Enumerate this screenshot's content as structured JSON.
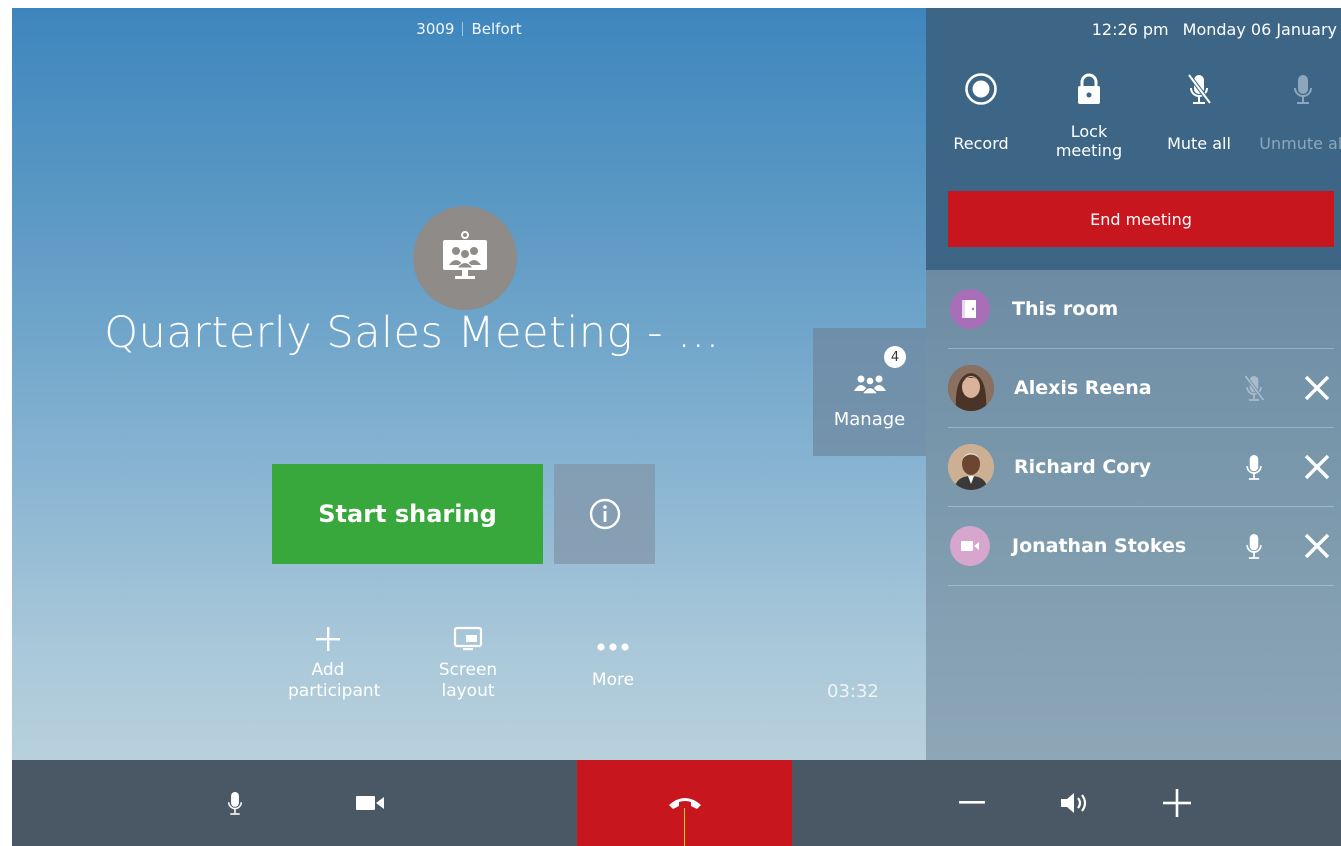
{
  "status": {
    "room_number": "3009",
    "room_name": "Belfort",
    "time": "12:26 pm",
    "date": "Monday 06 January"
  },
  "meeting": {
    "title": "Quarterly Sales Meeting - ...",
    "timer": "03:32",
    "icon": "video-conference-icon"
  },
  "main_actions": {
    "start_sharing": "Start sharing",
    "info_icon": "info-icon",
    "add_participant": "Add participant",
    "screen_layout": "Screen layout",
    "more": "More"
  },
  "manage": {
    "label": "Manage",
    "count": "4",
    "icon": "people-icon"
  },
  "panel": {
    "controls": {
      "record": "Record",
      "lock": "Lock meeting",
      "mute_all": "Mute all",
      "unmute_all": "Unmute all"
    },
    "end_meeting": "End meeting",
    "participants": [
      {
        "name": "This room",
        "avatar": "door-icon",
        "avatar_color": "#a86fb8"
      },
      {
        "name": "Alexis Reena",
        "avatar": "photo",
        "mic": "muted"
      },
      {
        "name": "Richard Cory",
        "avatar": "photo",
        "mic": "on"
      },
      {
        "name": "Jonathan Stokes",
        "avatar": "camera-icon",
        "avatar_color": "#d6a6cf",
        "mic": "on"
      }
    ]
  },
  "bottom_bar": {
    "icons": [
      "microphone-icon",
      "camera-icon",
      "hangup-icon",
      "volume-down-icon",
      "speaker-icon",
      "volume-up-icon"
    ]
  },
  "colors": {
    "green": "#39a83c",
    "red": "#c8161f",
    "panel_dark": "#3d6686",
    "bar": "#495864"
  }
}
